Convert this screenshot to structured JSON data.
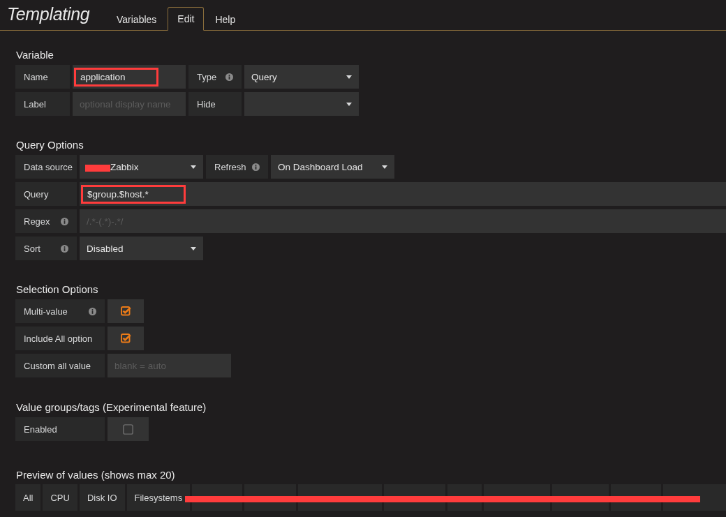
{
  "header": {
    "title": "Templating",
    "tabs": [
      {
        "label": "Variables",
        "selected": false
      },
      {
        "label": "Edit",
        "selected": true
      },
      {
        "label": "Help",
        "selected": false
      }
    ]
  },
  "sections": [
    {
      "title": "Variable",
      "rows": [
        {
          "fields": [
            {
              "kind": "label",
              "text": "Name",
              "info": false
            },
            {
              "kind": "input",
              "value": "application",
              "annotated": true
            },
            {
              "kind": "label",
              "text": "Type",
              "info": true
            },
            {
              "kind": "select",
              "value": "Query"
            }
          ]
        },
        {
          "fields": [
            {
              "kind": "label",
              "text": "Label",
              "info": false
            },
            {
              "kind": "input",
              "placeholder": "optional display name"
            },
            {
              "kind": "label",
              "text": "Hide",
              "info": false
            },
            {
              "kind": "select"
            }
          ]
        }
      ]
    },
    {
      "title": "Query Options",
      "rows": [
        {
          "fields": [
            {
              "kind": "label",
              "text": "Data source",
              "info": false
            },
            {
              "kind": "select",
              "value": "Zabbix",
              "redacted_prefix": true
            },
            {
              "kind": "label",
              "text": "Refresh",
              "info": true
            },
            {
              "kind": "select",
              "value": "On Dashboard Load"
            }
          ]
        },
        {
          "fields": [
            {
              "kind": "label",
              "text": "Query",
              "info": false
            },
            {
              "kind": "input",
              "value": "$group.$host.*",
              "annotated": true
            }
          ]
        },
        {
          "fields": [
            {
              "kind": "label",
              "text": "Regex",
              "info": true
            },
            {
              "kind": "input",
              "placeholder": "/.*-(.*)-.*/"
            }
          ]
        },
        {
          "fields": [
            {
              "kind": "label",
              "text": "Sort",
              "info": true
            },
            {
              "kind": "select",
              "value": "Disabled"
            }
          ]
        }
      ]
    },
    {
      "title": "Selection Options",
      "rows": [
        {
          "fields": [
            {
              "kind": "label",
              "text": "Multi-value",
              "info": true
            },
            {
              "kind": "checkbox",
              "checked": true
            }
          ]
        },
        {
          "fields": [
            {
              "kind": "label",
              "text": "Include All option",
              "info": false
            },
            {
              "kind": "checkbox",
              "checked": true
            }
          ]
        },
        {
          "fields": [
            {
              "kind": "label",
              "text": "Custom all value",
              "info": false
            },
            {
              "kind": "input",
              "placeholder": "blank = auto"
            }
          ]
        }
      ]
    },
    {
      "title": "Value groups/tags (Experimental feature)",
      "rows": [
        {
          "fields": [
            {
              "kind": "label",
              "text": "Enabled",
              "info": false
            },
            {
              "kind": "checkbox",
              "checked": false
            }
          ]
        }
      ]
    }
  ],
  "preview": {
    "title": "Preview of values (shows max 20)",
    "redaction_line": true,
    "tags": [
      {
        "kind": "tag",
        "label": "All"
      },
      {
        "kind": "tag",
        "label": "CPU"
      },
      {
        "kind": "tag",
        "label": "Disk IO"
      },
      {
        "kind": "tag",
        "label": "Filesystems"
      },
      {
        "kind": "redacted"
      },
      {
        "kind": "redacted"
      },
      {
        "kind": "redacted"
      },
      {
        "kind": "redacted"
      },
      {
        "kind": "redacted"
      },
      {
        "kind": "redacted"
      },
      {
        "kind": "redacted"
      },
      {
        "kind": "redacted"
      },
      {
        "kind": "redacted"
      }
    ]
  }
}
